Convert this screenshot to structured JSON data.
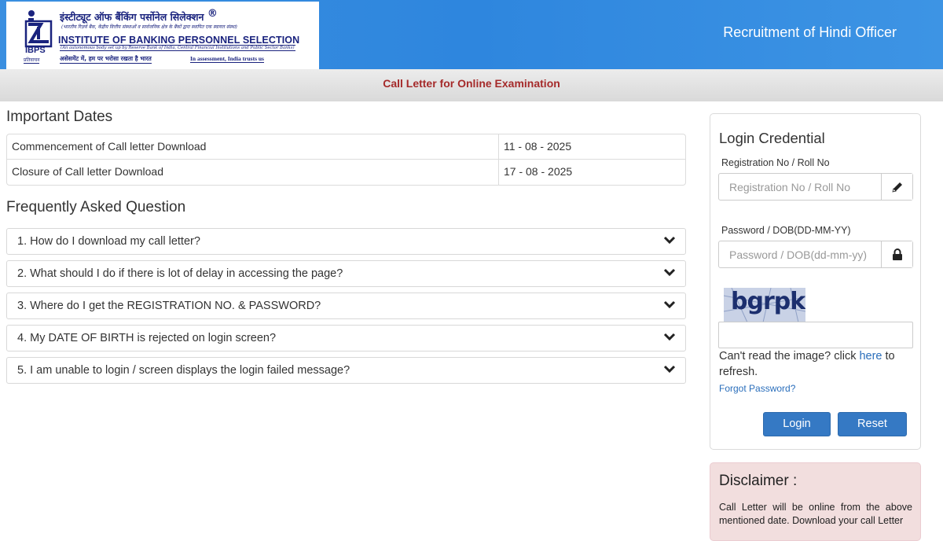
{
  "header": {
    "logo": {
      "hindi_name": "इंस्टीट्यूट ऑफ बैंकिंग पर्सोनेल सिलेक्शन",
      "registered_mark": "®",
      "hindi_subtitle": "(भारतीय रिज़र्व बैंक, केंद्रीय वित्तीय संस्थाओं व सार्वजनिक क्षेत्र के बैंकों द्वारा स्थापित एक स्वायत्त संस्था)",
      "english_name": "INSTITUTE OF BANKING PERSONNEL SELECTION",
      "english_subtitle": "(An autonomous body set up by Reserve Bank of India, Central Financial Institutions and Public Sector Banks)",
      "tagline_hindi": "असेसमेंट में, हम पर भरोसा रखता है भारत",
      "tagline_english": "In assessment, India trusts us",
      "abbr": "IBPS",
      "abbr_hindi": "प्रतिवाचन",
      "brand_color": "#1a237e"
    },
    "title": "Recruitment of Hindi Officer",
    "bg_color": "#2e86de"
  },
  "subbar": {
    "title": "Call Letter for Online Examination",
    "title_color": "#a52a2a"
  },
  "important_dates": {
    "heading": "Important Dates",
    "rows": [
      {
        "label": "Commencement of Call letter Download",
        "value": "11 - 08 - 2025"
      },
      {
        "label": "Closure of Call letter Download",
        "value": "17 - 08 - 2025"
      }
    ]
  },
  "faq": {
    "heading": "Frequently Asked Question",
    "items": [
      "1. How do I download my call letter?",
      "2. What should I do if there is lot of delay in accessing the page?",
      "3. Where do I get the REGISTRATION NO. & PASSWORD?",
      "4. My DATE OF BIRTH is rejected on login screen?",
      "5. I am unable to login / screen displays the login failed message?"
    ],
    "expand_icon": "chevron-down-icon"
  },
  "login": {
    "title": "Login Credential",
    "registration_label": "Registration No / Roll No",
    "registration_placeholder": "Registration No / Roll No",
    "registration_icon": "pencil-icon",
    "password_label": "Password / DOB(DD-MM-YY)",
    "password_placeholder": "Password / DOB(dd-mm-yy)",
    "password_icon": "lock-icon",
    "captcha_text": "bgrpk",
    "captcha_help_before": "Can't read the image? click ",
    "captcha_help_link": "here",
    "captcha_help_after": " to refresh.",
    "forgot_password": "Forgot Password?",
    "login_button": "Login",
    "reset_button": "Reset",
    "button_color": "#3579c4",
    "link_color": "#2a6ebb"
  },
  "disclaimer": {
    "title": "Disclaimer :",
    "text": "Call Letter will be online from the above mentioned date. Download your call Letter",
    "bg_color": "#f2dede"
  }
}
